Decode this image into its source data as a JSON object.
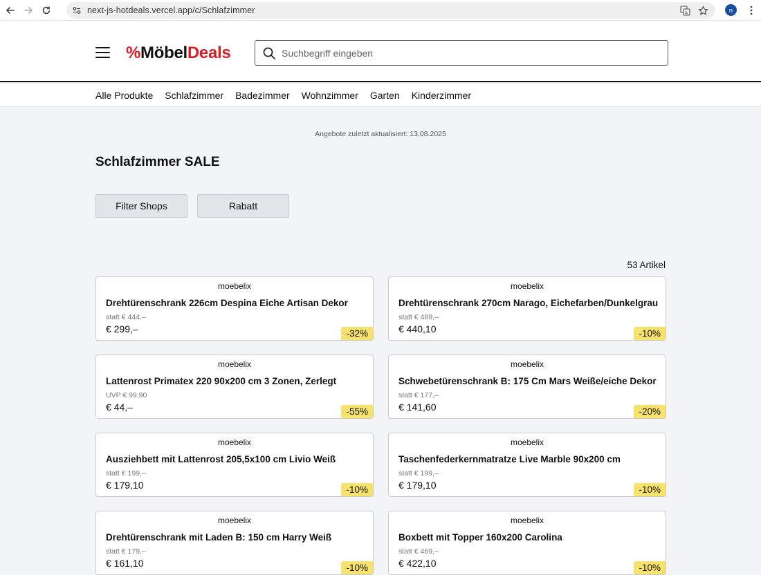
{
  "browser": {
    "url": "next-js-hotdeals.vercel.app/c/Schlafzimmer",
    "profile_initial": "n"
  },
  "header": {
    "logo": {
      "pct": "%",
      "moebel": "Möbel",
      "deals": "Deals"
    },
    "search_placeholder": "Suchbegriff eingeben"
  },
  "nav": {
    "items": [
      "Alle Produkte",
      "Schlafzimmer",
      "Badezimmer",
      "Wohnzimmer",
      "Garten",
      "Kinderzimmer"
    ]
  },
  "main": {
    "updated": "Angebote zuletzt aktualisiert: 13.08.2025",
    "title": "Schlafzimmer SALE",
    "filter_shops": "Filter Shops",
    "rabatt": "Rabatt",
    "count": "53 Artikel"
  },
  "products": [
    {
      "shop": "moebelix",
      "title": "Drehtürenschrank 226cm Despina Eiche Artisan Dekor",
      "old": "statt € 444,–",
      "price": "€ 299,–",
      "discount": "-32%"
    },
    {
      "shop": "moebelix",
      "title": "Drehtürenschrank 270cm Narago, Eichefarben/Dunkelgrau",
      "old": "statt € 489,–",
      "price": "€ 440,10",
      "discount": "-10%"
    },
    {
      "shop": "moebelix",
      "title": "Lattenrost Primatex 220 90x200 cm 3 Zonen, Zerlegt",
      "old": "UVP € 99,90",
      "price": "€ 44,–",
      "discount": "-55%"
    },
    {
      "shop": "moebelix",
      "title": "Schwebetürenschrank B: 175 Cm Mars Weiße/eiche Dekor",
      "old": "statt € 177,–",
      "price": "€ 141,60",
      "discount": "-20%"
    },
    {
      "shop": "moebelix",
      "title": "Ausziehbett mit Lattenrost 205,5x100 cm Livio Weiß",
      "old": "statt € 199,–",
      "price": "€ 179,10",
      "discount": "-10%"
    },
    {
      "shop": "moebelix",
      "title": "Taschenfederkernmatratze Live Marble 90x200 cm",
      "old": "statt € 199,–",
      "price": "€ 179,10",
      "discount": "-10%"
    },
    {
      "shop": "moebelix",
      "title": "Drehtürenschrank mit Laden B: 150 cm Harry Weiß",
      "old": "statt € 179,–",
      "price": "€ 161,10",
      "discount": "-10%"
    },
    {
      "shop": "moebelix",
      "title": "Boxbett mit Topper 160x200 Carolina",
      "old": "statt € 469,–",
      "price": "€ 422,10",
      "discount": "-10%"
    }
  ],
  "colors": {
    "brand_red": "#d51f26",
    "badge_yellow": "#f7e26b",
    "background": "#f3f4f6"
  }
}
